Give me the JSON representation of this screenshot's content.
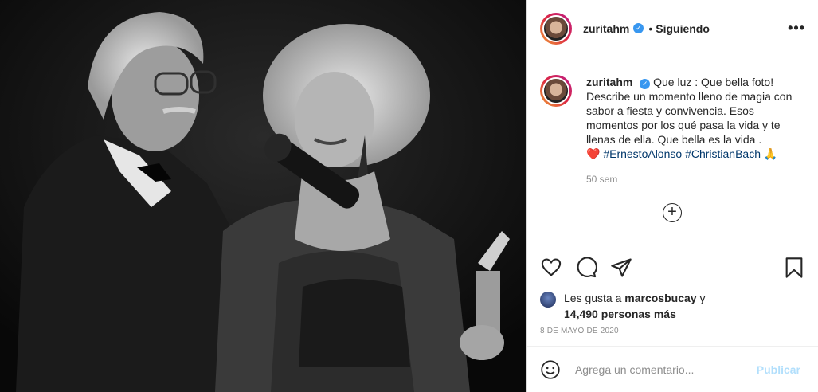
{
  "header": {
    "username": "zuritahm",
    "verified_icon": "verified-badge-icon",
    "separator": "•",
    "following_label": "Siguiendo",
    "more_label": "•••"
  },
  "caption": {
    "username": "zuritahm",
    "text": "Que luz : Que bella foto! Describe un momento lleno de magia con sabor a fiesta y convivencia. Esos momentos por los qué pasa la vida y te llenas de ella. Que bella es la vida .",
    "heart_emoji": "❤️",
    "hashtags": [
      "#ErnestoAlonso",
      "#ChristianBach"
    ],
    "pray_emoji": "🙏",
    "time": "50 sem",
    "load_more_label": "+"
  },
  "actions": {
    "like_icon": "heart-icon",
    "comment_icon": "comment-icon",
    "share_icon": "share-icon",
    "save_icon": "bookmark-icon"
  },
  "likes": {
    "prefix": "Les gusta a",
    "liker": "marcosbucay",
    "conjunction": "y",
    "others": "14,490 personas más"
  },
  "date": "8 DE MAYO DE 2020",
  "comment_box": {
    "placeholder": "Agrega un comentario...",
    "publish_label": "Publicar",
    "emoji_icon": "smiley-icon",
    "publish_color": "#b2dffc"
  },
  "colors": {
    "verified": "#3897f0",
    "hashtag": "#00376b",
    "muted": "#8e8e8e"
  }
}
